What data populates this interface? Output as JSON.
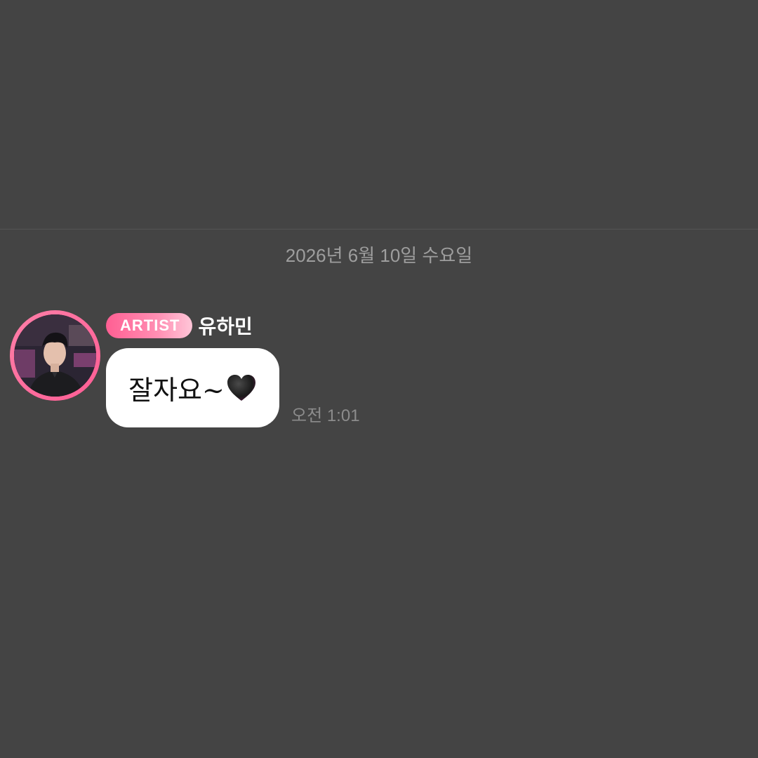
{
  "chat": {
    "date_separator": "2026년 6월 10일 수요일",
    "message": {
      "badge": "ARTIST",
      "sender": "유하민",
      "text": "잘자요~",
      "emoji": "black-heart-icon",
      "time": "오전 1:01"
    }
  },
  "colors": {
    "background": "#444444",
    "badge_start": "#ff5f93",
    "badge_end": "#ffc6d8",
    "bubble": "#ffffff",
    "avatar_ring": "#ff6f9e"
  }
}
